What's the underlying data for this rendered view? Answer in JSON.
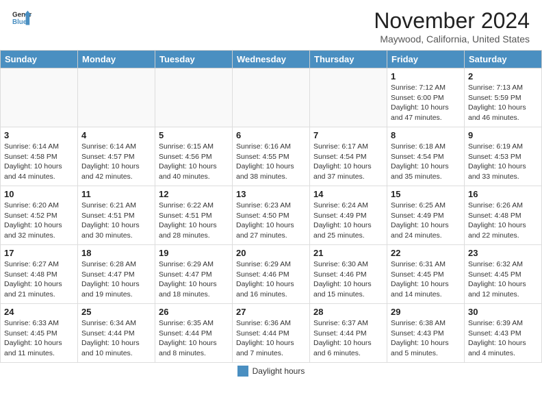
{
  "header": {
    "logo_line1": "General",
    "logo_line2": "Blue",
    "month": "November 2024",
    "location": "Maywood, California, United States"
  },
  "days_of_week": [
    "Sunday",
    "Monday",
    "Tuesday",
    "Wednesday",
    "Thursday",
    "Friday",
    "Saturday"
  ],
  "footer": {
    "legend_label": "Daylight hours"
  },
  "weeks": [
    {
      "days": [
        {
          "num": "",
          "info": ""
        },
        {
          "num": "",
          "info": ""
        },
        {
          "num": "",
          "info": ""
        },
        {
          "num": "",
          "info": ""
        },
        {
          "num": "",
          "info": ""
        },
        {
          "num": "1",
          "info": "Sunrise: 7:12 AM\nSunset: 6:00 PM\nDaylight: 10 hours and 47 minutes."
        },
        {
          "num": "2",
          "info": "Sunrise: 7:13 AM\nSunset: 5:59 PM\nDaylight: 10 hours and 46 minutes."
        }
      ]
    },
    {
      "days": [
        {
          "num": "3",
          "info": "Sunrise: 6:14 AM\nSunset: 4:58 PM\nDaylight: 10 hours and 44 minutes."
        },
        {
          "num": "4",
          "info": "Sunrise: 6:14 AM\nSunset: 4:57 PM\nDaylight: 10 hours and 42 minutes."
        },
        {
          "num": "5",
          "info": "Sunrise: 6:15 AM\nSunset: 4:56 PM\nDaylight: 10 hours and 40 minutes."
        },
        {
          "num": "6",
          "info": "Sunrise: 6:16 AM\nSunset: 4:55 PM\nDaylight: 10 hours and 38 minutes."
        },
        {
          "num": "7",
          "info": "Sunrise: 6:17 AM\nSunset: 4:54 PM\nDaylight: 10 hours and 37 minutes."
        },
        {
          "num": "8",
          "info": "Sunrise: 6:18 AM\nSunset: 4:54 PM\nDaylight: 10 hours and 35 minutes."
        },
        {
          "num": "9",
          "info": "Sunrise: 6:19 AM\nSunset: 4:53 PM\nDaylight: 10 hours and 33 minutes."
        }
      ]
    },
    {
      "days": [
        {
          "num": "10",
          "info": "Sunrise: 6:20 AM\nSunset: 4:52 PM\nDaylight: 10 hours and 32 minutes."
        },
        {
          "num": "11",
          "info": "Sunrise: 6:21 AM\nSunset: 4:51 PM\nDaylight: 10 hours and 30 minutes."
        },
        {
          "num": "12",
          "info": "Sunrise: 6:22 AM\nSunset: 4:51 PM\nDaylight: 10 hours and 28 minutes."
        },
        {
          "num": "13",
          "info": "Sunrise: 6:23 AM\nSunset: 4:50 PM\nDaylight: 10 hours and 27 minutes."
        },
        {
          "num": "14",
          "info": "Sunrise: 6:24 AM\nSunset: 4:49 PM\nDaylight: 10 hours and 25 minutes."
        },
        {
          "num": "15",
          "info": "Sunrise: 6:25 AM\nSunset: 4:49 PM\nDaylight: 10 hours and 24 minutes."
        },
        {
          "num": "16",
          "info": "Sunrise: 6:26 AM\nSunset: 4:48 PM\nDaylight: 10 hours and 22 minutes."
        }
      ]
    },
    {
      "days": [
        {
          "num": "17",
          "info": "Sunrise: 6:27 AM\nSunset: 4:48 PM\nDaylight: 10 hours and 21 minutes."
        },
        {
          "num": "18",
          "info": "Sunrise: 6:28 AM\nSunset: 4:47 PM\nDaylight: 10 hours and 19 minutes."
        },
        {
          "num": "19",
          "info": "Sunrise: 6:29 AM\nSunset: 4:47 PM\nDaylight: 10 hours and 18 minutes."
        },
        {
          "num": "20",
          "info": "Sunrise: 6:29 AM\nSunset: 4:46 PM\nDaylight: 10 hours and 16 minutes."
        },
        {
          "num": "21",
          "info": "Sunrise: 6:30 AM\nSunset: 4:46 PM\nDaylight: 10 hours and 15 minutes."
        },
        {
          "num": "22",
          "info": "Sunrise: 6:31 AM\nSunset: 4:45 PM\nDaylight: 10 hours and 14 minutes."
        },
        {
          "num": "23",
          "info": "Sunrise: 6:32 AM\nSunset: 4:45 PM\nDaylight: 10 hours and 12 minutes."
        }
      ]
    },
    {
      "days": [
        {
          "num": "24",
          "info": "Sunrise: 6:33 AM\nSunset: 4:45 PM\nDaylight: 10 hours and 11 minutes."
        },
        {
          "num": "25",
          "info": "Sunrise: 6:34 AM\nSunset: 4:44 PM\nDaylight: 10 hours and 10 minutes."
        },
        {
          "num": "26",
          "info": "Sunrise: 6:35 AM\nSunset: 4:44 PM\nDaylight: 10 hours and 8 minutes."
        },
        {
          "num": "27",
          "info": "Sunrise: 6:36 AM\nSunset: 4:44 PM\nDaylight: 10 hours and 7 minutes."
        },
        {
          "num": "28",
          "info": "Sunrise: 6:37 AM\nSunset: 4:44 PM\nDaylight: 10 hours and 6 minutes."
        },
        {
          "num": "29",
          "info": "Sunrise: 6:38 AM\nSunset: 4:43 PM\nDaylight: 10 hours and 5 minutes."
        },
        {
          "num": "30",
          "info": "Sunrise: 6:39 AM\nSunset: 4:43 PM\nDaylight: 10 hours and 4 minutes."
        }
      ]
    }
  ]
}
